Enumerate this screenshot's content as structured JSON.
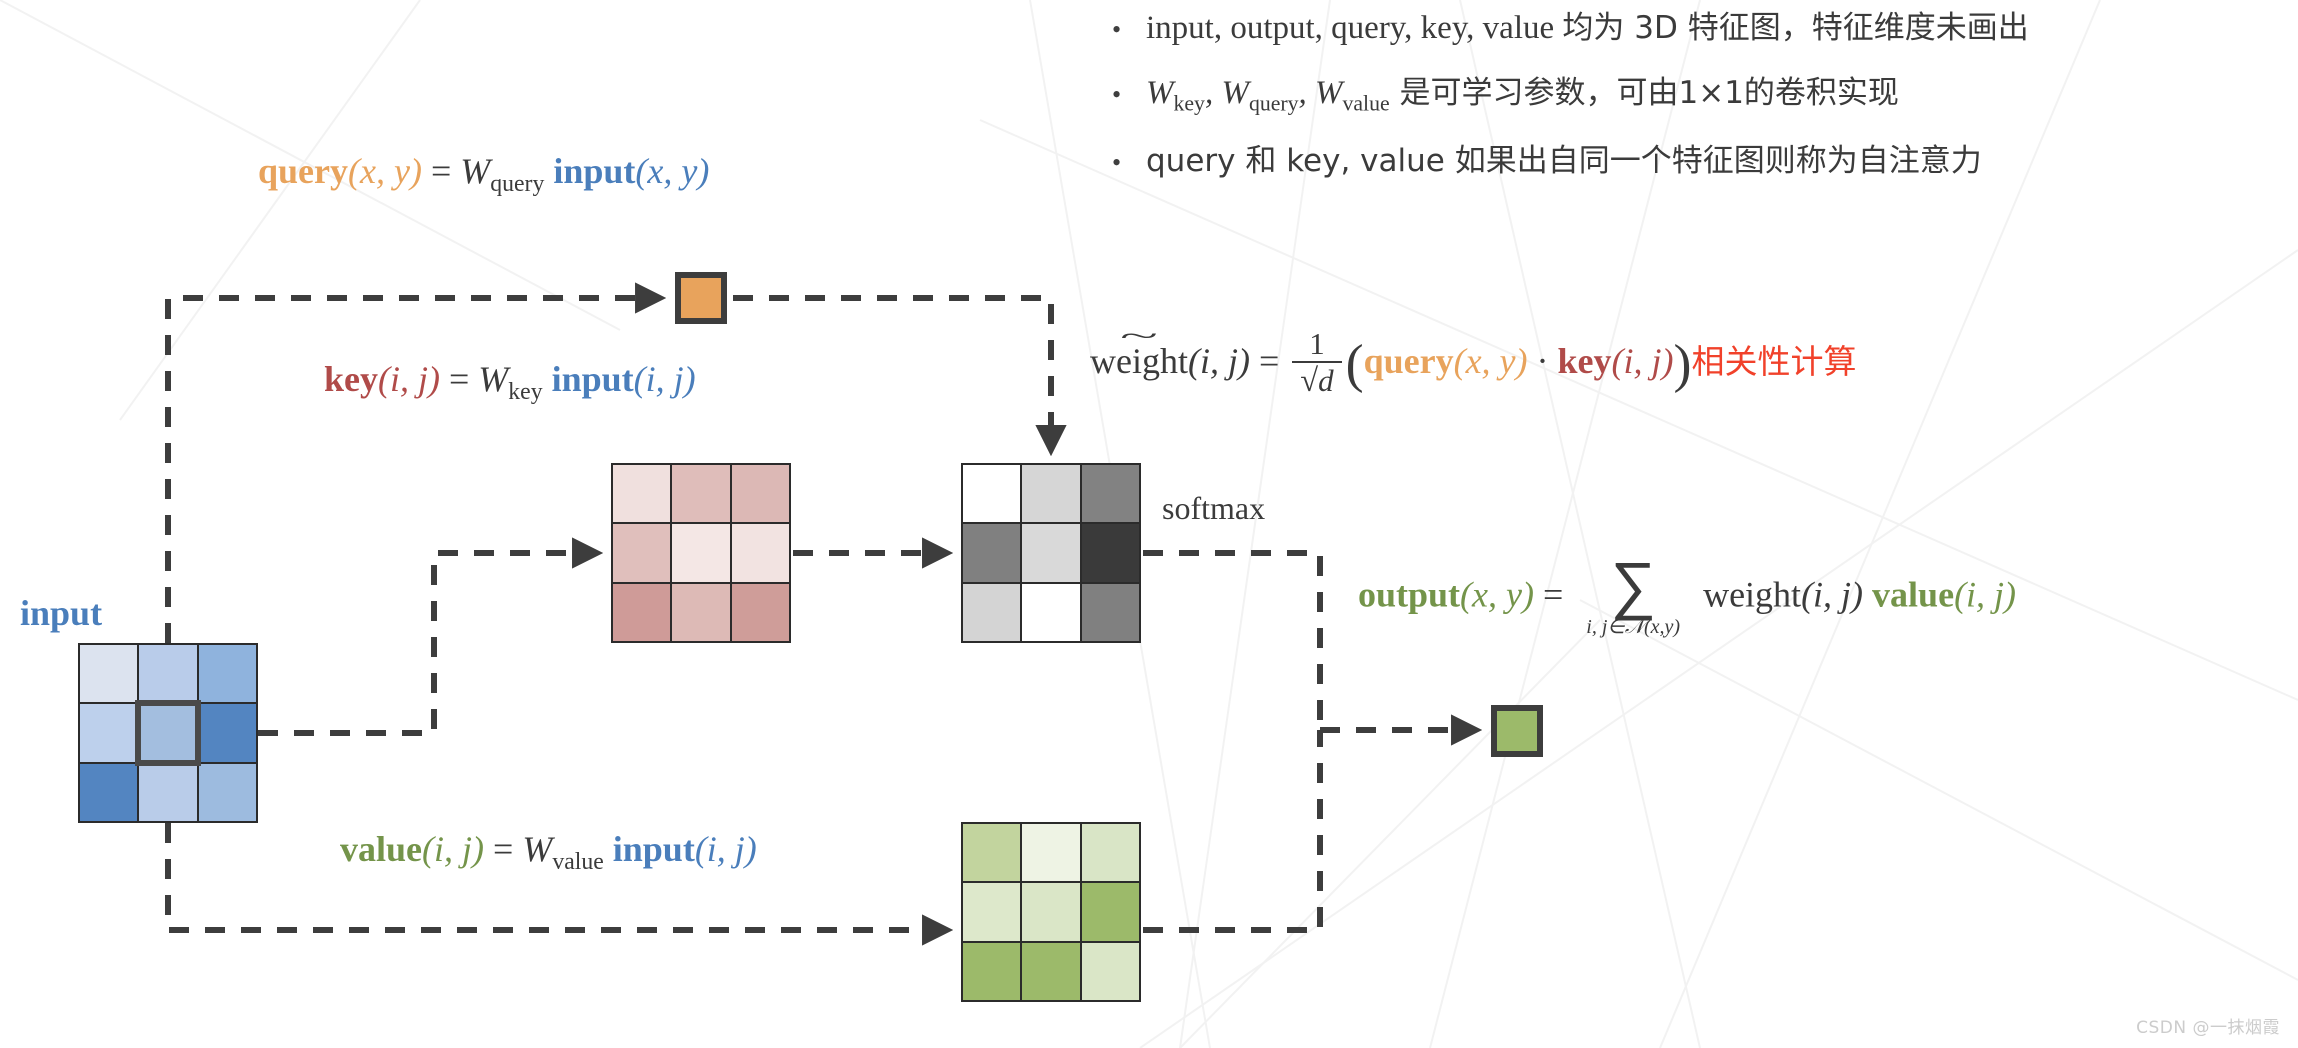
{
  "watermark": "CSDN @一抹烟霞",
  "bullets": [
    {
      "marker": "•",
      "segments": [
        {
          "text": "input, output, query, key, value ",
          "style": "serif"
        },
        {
          "text": "均为 3D 特征图，特征维度未画出",
          "style": "cjk"
        }
      ],
      "plain": "input, output, query, key, value 均为 3D 特征图，特征维度未画出"
    },
    {
      "marker": "•",
      "segments": [
        {
          "text": "W",
          "style": "italic"
        },
        {
          "text": "key",
          "style": "sub"
        },
        {
          "text": ", W",
          "style": "italic"
        },
        {
          "text": "query",
          "style": "sub"
        },
        {
          "text": ", W",
          "style": "italic"
        },
        {
          "text": "value",
          "style": "sub"
        },
        {
          "text": " 是可学习参数，可由1×1的卷积实现",
          "style": "cjk"
        }
      ],
      "plain": "W_key, W_query, W_value 是可学习参数，可由1×1的卷积实现"
    },
    {
      "marker": "•",
      "segments": [
        {
          "text": "query 和 key, value 如果出自同一个特征图则称为自注意力",
          "style": "cjk"
        }
      ],
      "plain": "query 和 key, value 如果出自同一个特征图则称为自注意力"
    }
  ],
  "formulas": {
    "query": {
      "lhs_name": "query",
      "lhs_args": "(x, y)",
      "eq": "=",
      "w_base": "W",
      "w_sub": "query",
      "rhs_name": "input",
      "rhs_args": "(x, y)"
    },
    "key": {
      "lhs_name": "key",
      "lhs_args": "(i, j)",
      "eq": "=",
      "w_base": "W",
      "w_sub": "key",
      "rhs_name": "input",
      "rhs_args": "(i, j)"
    },
    "value": {
      "lhs_name": "value",
      "lhs_args": "(i, j)",
      "eq": "=",
      "w_base": "W",
      "w_sub": "value",
      "rhs_name": "input",
      "rhs_args": "(i, j)"
    },
    "weight": {
      "lhs_name": "weight",
      "lhs_tilde": "~",
      "lhs_args": "(i, j)",
      "eq": "=",
      "frac_num": "1",
      "frac_den": "d",
      "open_paren": "(",
      "query_name": "query",
      "query_args": "(x, y)",
      "dot": "·",
      "key_name": "key",
      "key_args": "(i, j)",
      "close_paren": ")",
      "annotation": "相关性计算"
    },
    "output": {
      "lhs_name": "output",
      "lhs_args": "(x, y)",
      "eq": "=",
      "sum_symbol": "∑",
      "sum_limits": "i, j∈𝒩(x,y)",
      "weight_name": "weight",
      "weight_args": "(i, j)",
      "value_name": "value",
      "value_args": "(i, j)"
    }
  },
  "labels": {
    "input": "input",
    "softmax": "softmax"
  },
  "colors": {
    "query": "#e8a35c",
    "key": "#b04b49",
    "value": "#74944a",
    "input": "#4a7ebb",
    "annotation_red": "#f1412a",
    "outline": "#2b2b2b",
    "output_cell": "#9cba6a"
  },
  "grids": {
    "input": {
      "name": "input-feature-map",
      "rows": 3,
      "cols": 3,
      "cells": [
        [
          "#dce3ef",
          "#b9ccea",
          "#8fb3dd"
        ],
        [
          "#bdd0ec",
          "#a3bedf",
          "#5385c1"
        ],
        [
          "#5385c1",
          "#b9cce9",
          "#9dbbdf"
        ]
      ],
      "highlight": {
        "row": 1,
        "col": 1
      }
    },
    "key": {
      "name": "key-feature-map",
      "rows": 3,
      "cols": 3,
      "cells": [
        [
          "#f0e0de",
          "#dfbdba",
          "#dcb8b5"
        ],
        [
          "#e0bfbc",
          "#f4e7e5",
          "#f2e3e1"
        ],
        [
          "#cf9b98",
          "#ddbab6",
          "#cf9d99"
        ]
      ]
    },
    "softmax": {
      "name": "weight-map",
      "rows": 3,
      "cols": 3,
      "cells": [
        [
          "#ffffff",
          "#d6d6d6",
          "#828282"
        ],
        [
          "#808080",
          "#d9d9d9",
          "#3a3a3a"
        ],
        [
          "#d4d4d4",
          "#ffffff",
          "#808080"
        ]
      ]
    },
    "value": {
      "name": "value-feature-map",
      "rows": 3,
      "cols": 3,
      "cells": [
        [
          "#c2d49e",
          "#eef3e4",
          "#d9e5c6"
        ],
        [
          "#dde8cb",
          "#dae6c7",
          "#9cba6a"
        ],
        [
          "#9cba6a",
          "#9cba6a",
          "#dae6c7"
        ]
      ]
    }
  },
  "single_cells": {
    "query": {
      "name": "query-vector-cell",
      "color": "#e8a35c"
    },
    "output": {
      "name": "output-vector-cell",
      "color": "#9cba6a"
    }
  }
}
